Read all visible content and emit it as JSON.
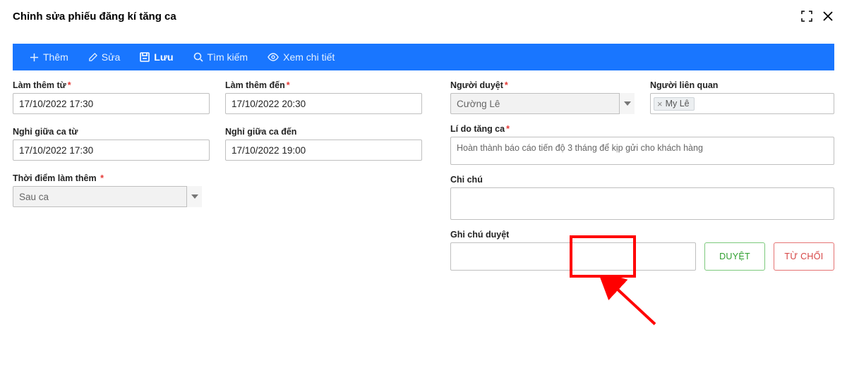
{
  "header": {
    "title": "Chỉnh sửa phiếu đăng kí tăng ca"
  },
  "toolbar": {
    "add": "Thêm",
    "edit": "Sửa",
    "save": "Lưu",
    "search": "Tìm kiếm",
    "detail": "Xem chi tiết"
  },
  "fields": {
    "from": {
      "label": "Làm thêm từ",
      "value": "17/10/2022 17:30"
    },
    "to": {
      "label": "Làm thêm đến",
      "value": "17/10/2022 20:30"
    },
    "breakFrom": {
      "label": "Nghỉ giữa ca từ",
      "value": "17/10/2022 17:30"
    },
    "breakTo": {
      "label": "Nghỉ giữa ca đến",
      "value": "17/10/2022 19:00"
    },
    "otTime": {
      "label": "Thời điểm làm thêm",
      "value": "Sau ca"
    },
    "approver": {
      "label": "Người duyệt",
      "value": "Cường Lê"
    },
    "related": {
      "label": "Người liên quan"
    },
    "relatedTags": [
      "My Lê"
    ],
    "reason": {
      "label": "Lí do tăng ca",
      "value": "Hoàn thành báo cáo tiến độ 3 tháng để kịp gửi cho khách hàng"
    },
    "note": {
      "label": "Chi chú",
      "value": ""
    },
    "approveNote": {
      "label": "Ghi chú duyệt",
      "value": ""
    }
  },
  "buttons": {
    "approve": "DUYỆT",
    "reject": "TỪ CHỐI"
  }
}
